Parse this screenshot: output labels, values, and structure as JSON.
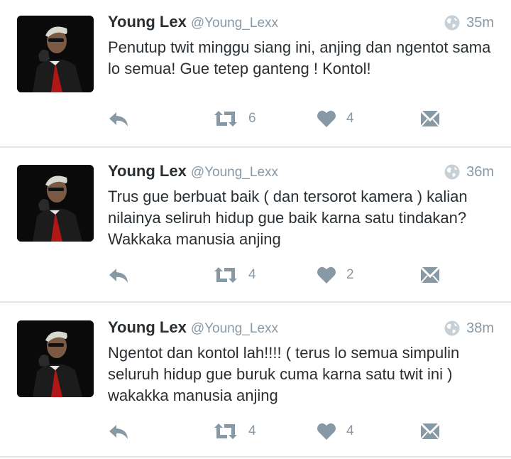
{
  "tweets": [
    {
      "name": "Young Lex",
      "handle": "@Young_Lexx",
      "time": "35m",
      "text": "Penutup twit minggu siang ini, anjing dan ngentot sama lo semua! Gue tetep ganteng ! Kontol!",
      "retweets": "6",
      "likes": "4"
    },
    {
      "name": "Young Lex",
      "handle": "@Young_Lexx",
      "time": "36m",
      "text": "Trus gue berbuat baik ( dan tersorot kamera ) kalian nilainya seliruh hidup gue baik karna satu tindakan? Wakkaka manusia anjing",
      "retweets": "4",
      "likes": "2"
    },
    {
      "name": "Young Lex",
      "handle": "@Young_Lexx",
      "time": "38m",
      "text": "Ngentot dan kontol lah!!!! ( terus lo semua simpulin seluruh hidup gue buruk cuma karna satu twit ini ) wakakka manusia anjing",
      "retweets": "4",
      "likes": "4"
    }
  ],
  "icons": {
    "globe": "globe-icon",
    "reply": "reply-icon",
    "retweet": "retweet-icon",
    "like": "heart-icon",
    "message": "envelope-icon"
  },
  "colors": {
    "icon_gray": "#8899a6",
    "text": "#292f33",
    "divider": "#e1e8ed"
  }
}
